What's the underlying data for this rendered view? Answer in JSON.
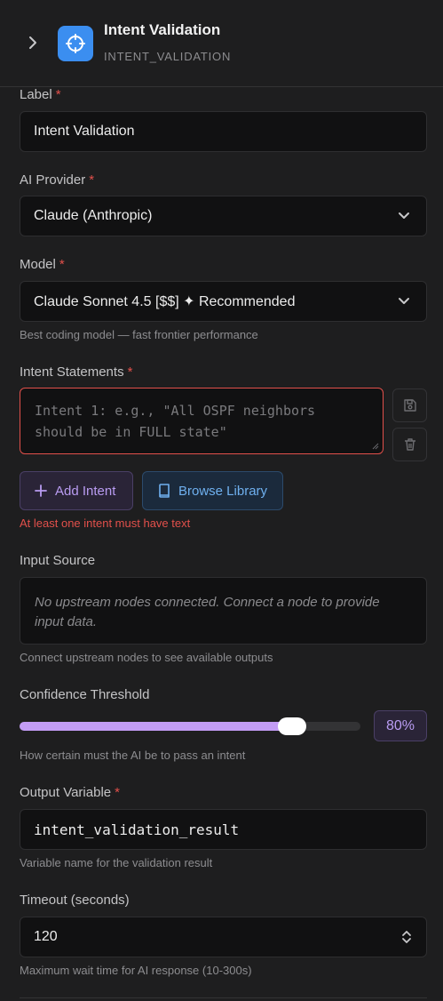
{
  "header": {
    "title": "Intent Validation",
    "type": "INTENT_VALIDATION",
    "icon": "crosshair-icon",
    "accent": "#3b8ef0"
  },
  "label_field": {
    "label": "Label",
    "required": "*",
    "value": "Intent Validation"
  },
  "provider": {
    "label": "AI Provider",
    "required": "*",
    "value": "Claude (Anthropic)"
  },
  "model": {
    "label": "Model",
    "required": "*",
    "value": "Claude Sonnet 4.5 [$$] ✦ Recommended",
    "hint": "Best coding model — fast frontier performance"
  },
  "intents": {
    "label": "Intent Statements",
    "required": "*",
    "placeholder": "Intent 1: e.g., \"All OSPF neighbors should be in FULL state\"",
    "add_label": "Add Intent",
    "library_label": "Browse Library",
    "error": "At least one intent must have text"
  },
  "input_source": {
    "label": "Input Source",
    "empty_text": "No upstream nodes connected. Connect a node to provide input data.",
    "hint": "Connect upstream nodes to see available outputs"
  },
  "confidence": {
    "label": "Confidence Threshold",
    "value": 80,
    "display": "80%",
    "hint": "How certain must the AI be to pass an intent",
    "color": "#c39cf5"
  },
  "output_variable": {
    "label": "Output Variable",
    "required": "*",
    "value": "intent_validation_result",
    "hint": "Variable name for the validation result"
  },
  "timeout": {
    "label": "Timeout (seconds)",
    "value": "120",
    "hint": "Maximum wait time for AI response (10-300s)"
  },
  "colors": {
    "error": "#e2504b",
    "background": "#1e1e1f",
    "input_bg": "#111112"
  }
}
